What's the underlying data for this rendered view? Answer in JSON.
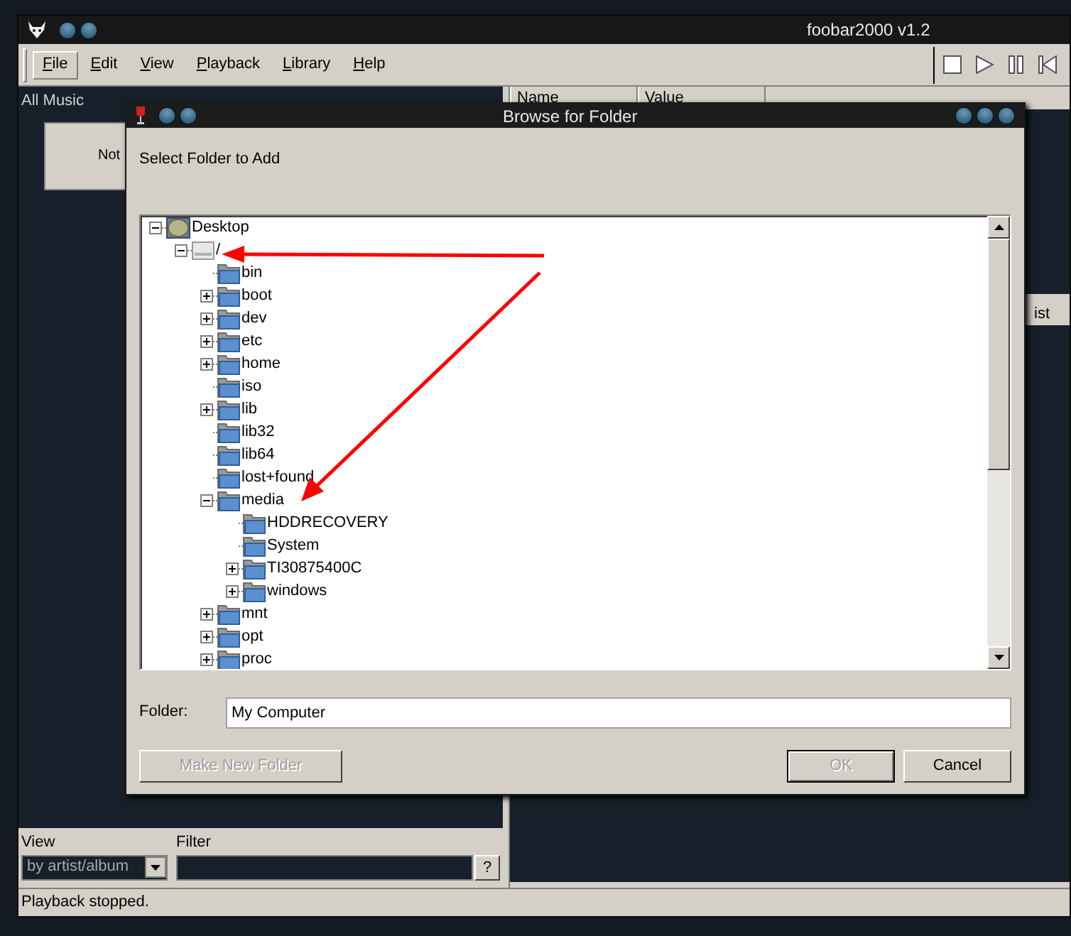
{
  "main_window": {
    "title": "foobar2000 v1.2",
    "menu": [
      {
        "label": "File",
        "selected": true
      },
      {
        "label": "Edit",
        "selected": false
      },
      {
        "label": "View",
        "selected": false
      },
      {
        "label": "Playback",
        "selected": false
      },
      {
        "label": "Library",
        "selected": false
      },
      {
        "label": "Help",
        "selected": false
      }
    ],
    "library_panel": {
      "title": "All Music",
      "button_fragment": "Not"
    },
    "properties_panel": {
      "columns": [
        "Name",
        "Value"
      ],
      "playlist_fragment": "ist"
    },
    "view": {
      "label": "View",
      "value": "by artist/album"
    },
    "filter": {
      "label": "Filter",
      "help": "?"
    },
    "status_bar": "Playback stopped."
  },
  "dialog": {
    "title": "Browse for Folder",
    "prompt": "Select Folder to Add",
    "tree": [
      {
        "label": "Desktop",
        "kind": "desktop",
        "expanded": true,
        "children": [
          {
            "label": "/",
            "kind": "drive",
            "expanded": true,
            "children": [
              {
                "label": "bin",
                "kind": "folder"
              },
              {
                "label": "boot",
                "kind": "folder",
                "expanded": false
              },
              {
                "label": "dev",
                "kind": "folder",
                "expanded": false
              },
              {
                "label": "etc",
                "kind": "folder",
                "expanded": false
              },
              {
                "label": "home",
                "kind": "folder",
                "expanded": false
              },
              {
                "label": "iso",
                "kind": "folder"
              },
              {
                "label": "lib",
                "kind": "folder",
                "expanded": false
              },
              {
                "label": "lib32",
                "kind": "folder"
              },
              {
                "label": "lib64",
                "kind": "folder"
              },
              {
                "label": "lost+found",
                "kind": "folder"
              },
              {
                "label": "media",
                "kind": "folder",
                "expanded": true,
                "children": [
                  {
                    "label": "HDDRECOVERY",
                    "kind": "folder"
                  },
                  {
                    "label": "System",
                    "kind": "folder"
                  },
                  {
                    "label": "TI30875400C",
                    "kind": "folder",
                    "expanded": false
                  },
                  {
                    "label": "windows",
                    "kind": "folder",
                    "expanded": false
                  }
                ]
              },
              {
                "label": "mnt",
                "kind": "folder",
                "expanded": false
              },
              {
                "label": "opt",
                "kind": "folder",
                "expanded": false
              },
              {
                "label": "proc",
                "kind": "folder",
                "expanded": false
              }
            ]
          }
        ]
      }
    ],
    "folder": {
      "label": "Folder:",
      "value": "My Computer"
    },
    "buttons": [
      {
        "label": "Make New Folder",
        "disabled": true,
        "default": false
      },
      {
        "label": "OK",
        "disabled": true,
        "default": true
      },
      {
        "label": "Cancel",
        "disabled": false,
        "default": false
      }
    ]
  }
}
